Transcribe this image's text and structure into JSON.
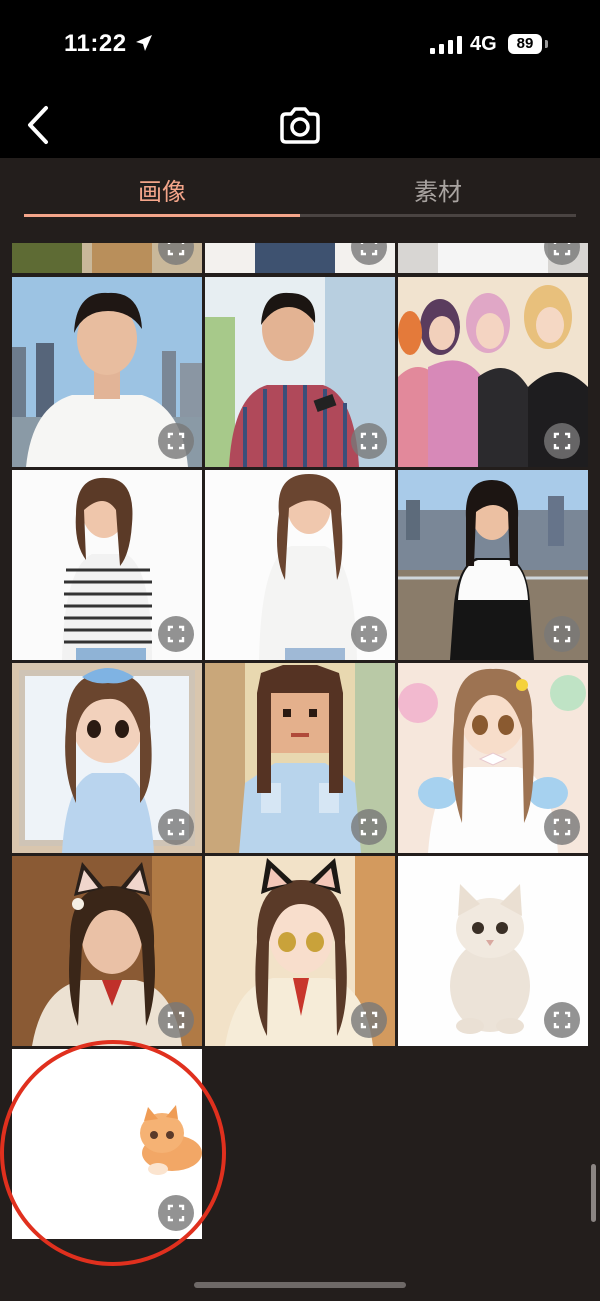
{
  "status_bar": {
    "time": "11:22",
    "network": "4G",
    "battery": "89"
  },
  "nav": {
    "back_icon": "chevron-left-icon",
    "camera_icon": "camera-icon"
  },
  "tabs": [
    {
      "label": "画像",
      "selected": true
    },
    {
      "label": "素材",
      "selected": false
    }
  ],
  "colors": {
    "accent": "#f4a58a",
    "background": "#231e1c",
    "highlight": "#e0301e"
  },
  "photos": [
    {
      "subject": "young man in white t-shirt, city skyline"
    },
    {
      "subject": "boy in plaid shirt holding phone"
    },
    {
      "subject": "group of girls with pink and blonde hair"
    },
    {
      "subject": "woman in striped long-sleeve top"
    },
    {
      "subject": "woman in white t-shirt"
    },
    {
      "subject": "woman on rooftop, city background"
    },
    {
      "subject": "chibi figure doll with blue bow"
    },
    {
      "subject": "pixel art girl in blue dress"
    },
    {
      "subject": "anime girl in frilly dress"
    },
    {
      "subject": "girl with cat ears, realistic"
    },
    {
      "subject": "anime girl with cat ears"
    },
    {
      "subject": "white kitten"
    },
    {
      "subject": "small orange kitten on white"
    }
  ]
}
